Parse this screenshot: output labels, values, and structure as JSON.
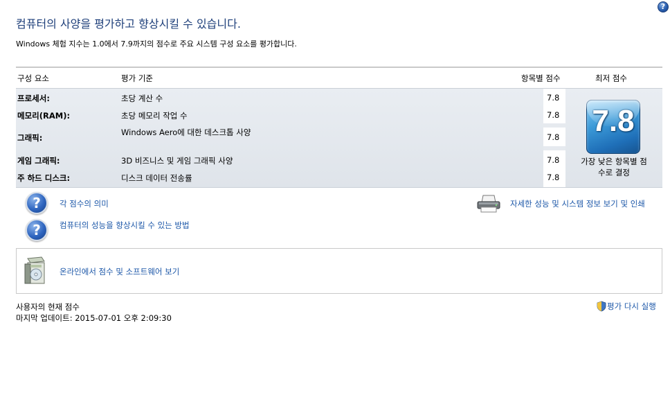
{
  "header": {
    "title": "컴퓨터의 사양을 평가하고 향상시킬 수 있습니다.",
    "description": "Windows 체험 지수는 1.0에서 7.9까지의 점수로 주요 시스템 구성 요소를 평가합니다.",
    "help_label": "?"
  },
  "table": {
    "col_component": "구성 요소",
    "col_criteria": "평가 기준",
    "col_subscore": "항목별 점수",
    "col_basescore": "최저 점수",
    "rows": [
      {
        "component": "프로세서:",
        "criteria": "초당 계산 수",
        "score": "7.8"
      },
      {
        "component": "메모리(RAM):",
        "criteria": "초당 메모리 작업 수",
        "score": "7.8"
      },
      {
        "component": "그래픽:",
        "criteria": "Windows Aero에 대한 데스크톱 사양",
        "score": "7.8"
      },
      {
        "component": "게임 그래픽:",
        "criteria": "3D 비즈니스 및 게임 그래픽 사양",
        "score": "7.8"
      },
      {
        "component": "주 하드 디스크:",
        "criteria": "디스크 데이터 전송률",
        "score": "7.8"
      }
    ],
    "base_score": "7.8",
    "base_caption": "가장 낮은 항목별 점수로 결정"
  },
  "links": {
    "meaning": "각 점수의 의미",
    "improve": "컴퓨터의 성능을 향상시킬 수 있는 방법",
    "details": "자세한 성능 및 시스템 정보 보기 및 인쇄",
    "online": "온라인에서 점수 및 소프트웨어 보기"
  },
  "footer": {
    "current_label": "사용자의 현재 점수",
    "last_update": "마지막 업데이트: 2015-07-01 오후 2:09:30",
    "rerun": "평가 다시 실행"
  },
  "colors": {
    "title": "#1e3f7a",
    "link": "#1c57a8",
    "table_bg": "#e4e8ed"
  }
}
